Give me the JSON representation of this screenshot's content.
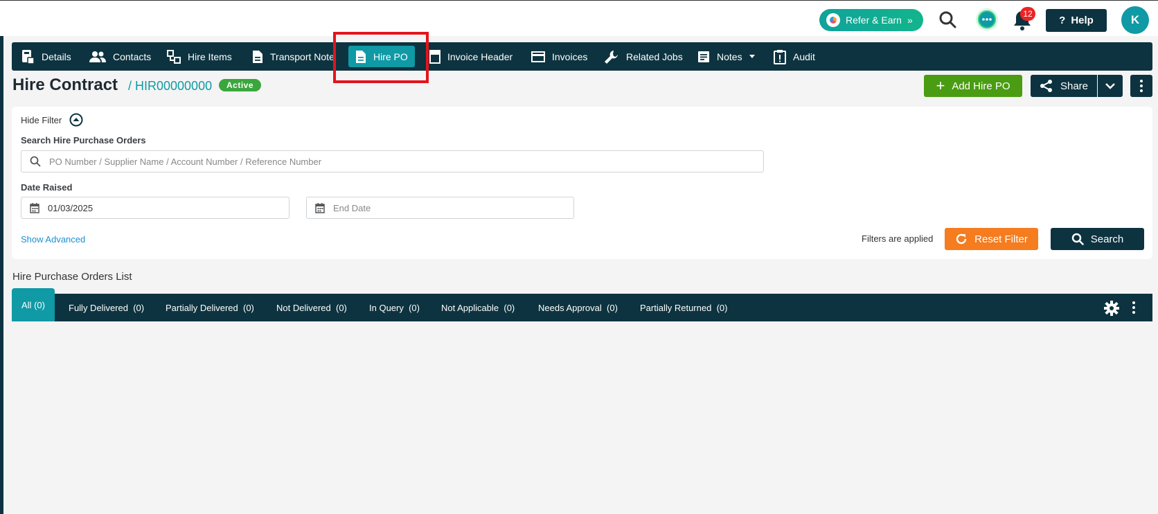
{
  "topbar": {
    "refer_label": "Refer & Earn",
    "notification_count": "12",
    "help_label": "Help",
    "avatar_initial": "K"
  },
  "nav": {
    "items": [
      {
        "label": "Details",
        "icon": "details-icon"
      },
      {
        "label": "Contacts",
        "icon": "contacts-icon"
      },
      {
        "label": "Hire Items",
        "icon": "hire-items-icon"
      },
      {
        "label": "Transport Note",
        "icon": "document-icon"
      },
      {
        "label": "Hire PO",
        "icon": "document-icon",
        "active": true
      },
      {
        "label": "Invoice Header",
        "icon": "invoice-header-icon"
      },
      {
        "label": "Invoices",
        "icon": "card-icon"
      },
      {
        "label": "Related Jobs",
        "icon": "wrench-icon"
      },
      {
        "label": "Notes",
        "icon": "notes-icon"
      },
      {
        "label": "Audit",
        "icon": "clipboard-icon"
      }
    ]
  },
  "header": {
    "title": "Hire Contract",
    "crumb": "/ HIR00000000",
    "status": "Active",
    "add_label": "Add Hire PO",
    "share_label": "Share"
  },
  "filter": {
    "hide_label": "Hide Filter",
    "search_label": "Search Hire Purchase Orders",
    "search_placeholder": "PO Number / Supplier Name / Account Number / Reference Number",
    "date_label": "Date Raised",
    "start_date": "01/03/2025",
    "end_placeholder": "End Date",
    "advanced_label": "Show Advanced",
    "applied_text": "Filters are applied",
    "reset_label": "Reset Filter",
    "search_button": "Search"
  },
  "list": {
    "title": "Hire Purchase Orders List",
    "tabs": [
      {
        "label": "All",
        "count": "(0)",
        "active": true
      },
      {
        "label": "Fully Delivered",
        "count": "(0)"
      },
      {
        "label": "Partially Delivered",
        "count": "(0)"
      },
      {
        "label": "Not Delivered",
        "count": "(0)"
      },
      {
        "label": "In Query",
        "count": "(0)"
      },
      {
        "label": "Not Applicable",
        "count": "(0)"
      },
      {
        "label": "Needs Approval",
        "count": "(0)"
      },
      {
        "label": "Partially Returned",
        "count": "(0)"
      }
    ]
  },
  "colors": {
    "navy": "#0d3340",
    "teal": "#0f9aa5",
    "green": "#4a9c12",
    "orange": "#f57c1f",
    "highlight": "#e3141b"
  }
}
